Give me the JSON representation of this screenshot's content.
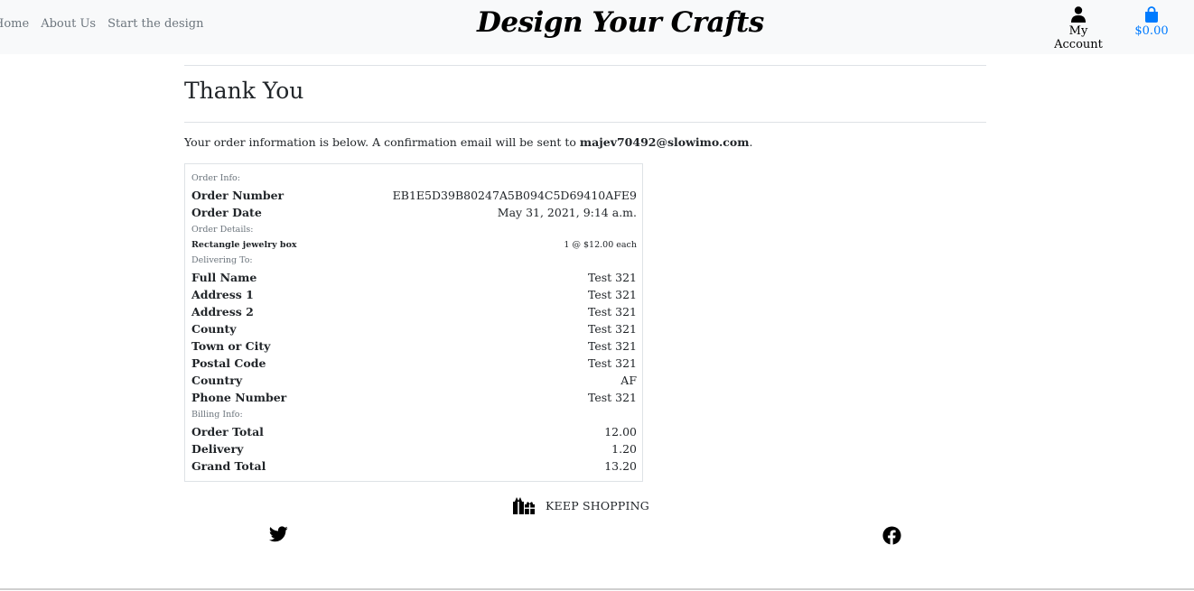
{
  "nav": {
    "home": "Home",
    "about": "About Us",
    "start": "Start the design"
  },
  "brand": {
    "logo": "Design Your Crafts"
  },
  "account": {
    "label": "My Account",
    "icon": "user-icon"
  },
  "cart": {
    "total": "$0.00",
    "icon": "shopping-bag-icon",
    "color": "#007bff"
  },
  "page": {
    "title": "Thank You",
    "intro_prefix": "Your order information is below. A confirmation email will be sent to ",
    "email": "majev70492@slowimo.com",
    "intro_suffix": "."
  },
  "order": {
    "section_info": "Order Info:",
    "order_number_label": "Order Number",
    "order_number": "EB1E5D39B80247A5B094C5D69410AFE9",
    "order_date_label": "Order Date",
    "order_date": "May 31, 2021, 9:14 a.m.",
    "section_details": "Order Details:",
    "item_name": "Rectangle jewelry box",
    "item_qty": "1 @ $12.00 each",
    "section_delivery": "Delivering To:",
    "delivery": [
      {
        "label": "Full Name",
        "value": "Test 321"
      },
      {
        "label": "Address 1",
        "value": "Test 321"
      },
      {
        "label": "Address 2",
        "value": "Test 321"
      },
      {
        "label": "County",
        "value": "Test 321"
      },
      {
        "label": "Town or City",
        "value": "Test 321"
      },
      {
        "label": "Postal Code",
        "value": "Test 321"
      },
      {
        "label": "Country",
        "value": "AF"
      },
      {
        "label": "Phone Number",
        "value": "Test 321"
      }
    ],
    "section_billing": "Billing Info:",
    "billing": [
      {
        "label": "Order Total",
        "value": "12.00"
      },
      {
        "label": "Delivery",
        "value": "1.20"
      },
      {
        "label": "Grand Total",
        "value": "13.20"
      }
    ]
  },
  "keep_shopping": {
    "label": "KEEP SHOPPING",
    "icon": "gifts-icon"
  },
  "social": {
    "twitter": "twitter-icon",
    "facebook": "facebook-icon"
  }
}
